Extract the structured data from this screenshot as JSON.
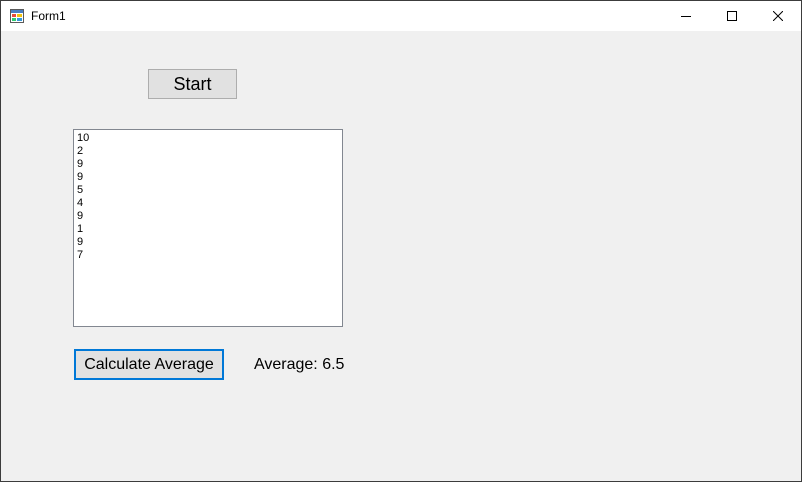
{
  "window": {
    "title": "Form1",
    "icon": "winforms-app-icon",
    "controls": [
      "minimize-icon",
      "maximize-icon",
      "close-icon"
    ]
  },
  "form": {
    "start_label": "Start",
    "list_items": [
      "10",
      "2",
      "9",
      "9",
      "5",
      "4",
      "9",
      "1",
      "9",
      "7"
    ],
    "calculate_label": "Calculate Average",
    "average_text": "Average: 6.5"
  },
  "colors": {
    "form_background": "#f0f0f0",
    "button_face": "#e1e1e1",
    "focus_border": "#0078d7"
  }
}
